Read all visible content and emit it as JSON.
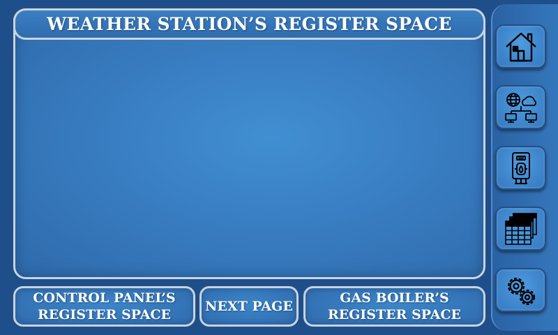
{
  "title": "WEATHER STATION’S REGISTER SPACE",
  "buttons": {
    "control_panel": "CONTROL PANEL’S\nREGISTER SPACE",
    "next_page": "NEXT PAGE",
    "gas_boiler": "GAS BOILER’S\nREGISTER SPACE"
  },
  "sidebar": {
    "items": [
      {
        "icon": "home-icon"
      },
      {
        "icon": "network-icon"
      },
      {
        "icon": "boiler-icon"
      },
      {
        "icon": "table-icon"
      },
      {
        "icon": "gears-icon"
      }
    ]
  },
  "colors": {
    "background": "#1f4f8a",
    "panel": "#3a80c4",
    "border": "#c9d3df",
    "text": "#ffffff"
  }
}
